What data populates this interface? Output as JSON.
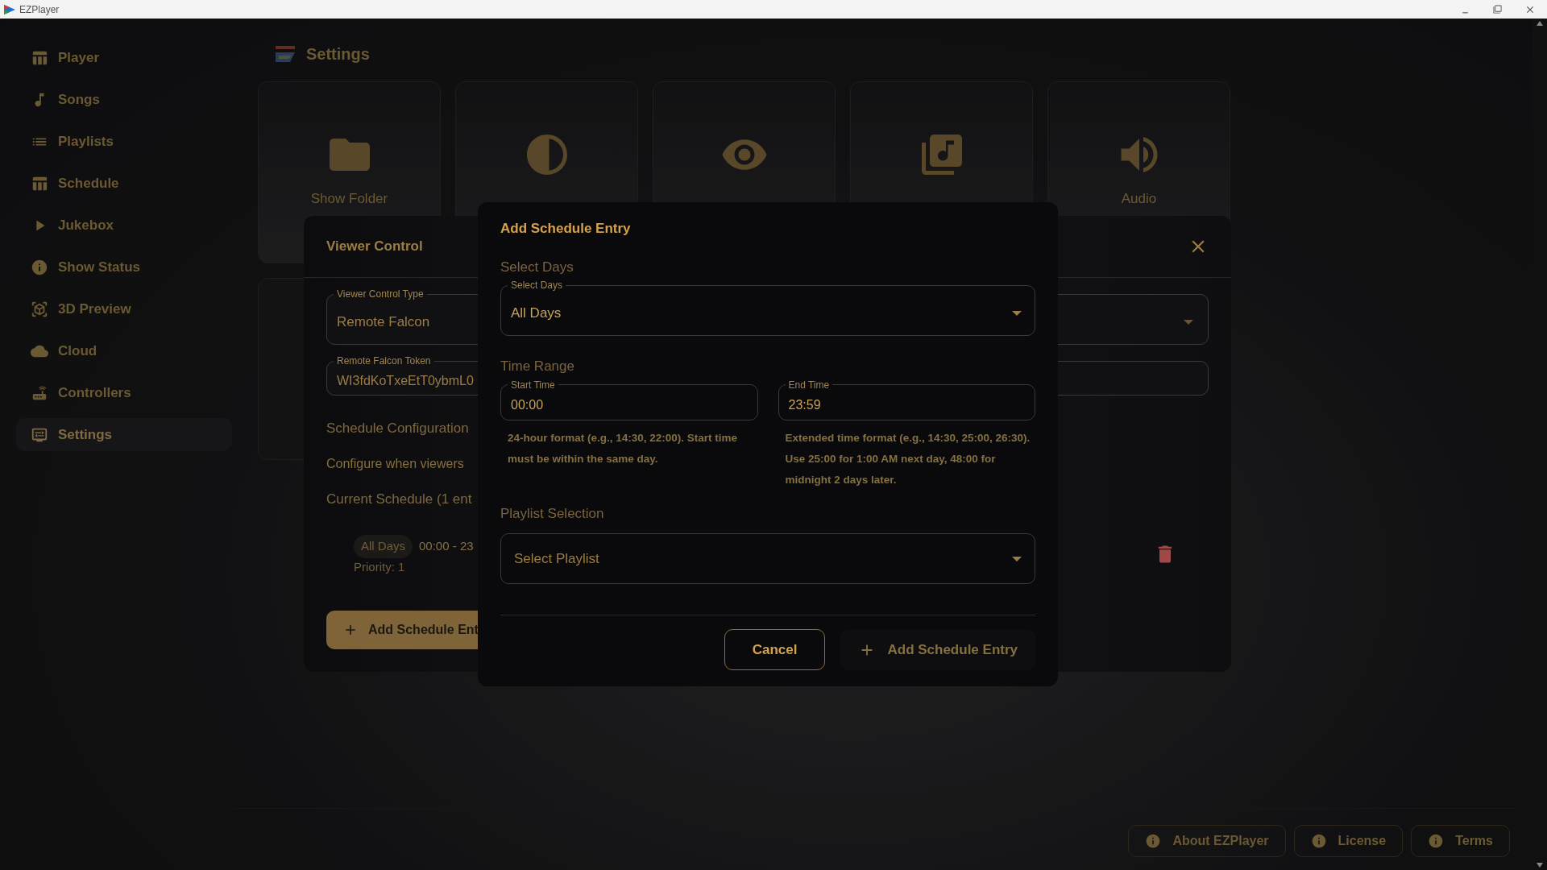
{
  "window": {
    "title": "EZPlayer"
  },
  "sidebar": {
    "items": [
      {
        "label": "Player",
        "selected": false
      },
      {
        "label": "Songs",
        "selected": false
      },
      {
        "label": "Playlists",
        "selected": false
      },
      {
        "label": "Schedule",
        "selected": false
      },
      {
        "label": "Jukebox",
        "selected": false
      },
      {
        "label": "Show Status",
        "selected": false
      },
      {
        "label": "3D Preview",
        "selected": false
      },
      {
        "label": "Cloud",
        "selected": false
      },
      {
        "label": "Controllers",
        "selected": false
      },
      {
        "label": "Settings",
        "selected": true
      }
    ]
  },
  "page": {
    "title": "Settings"
  },
  "cards": [
    {
      "kind": "labeled",
      "label": "Show Folder"
    },
    {
      "kind": "covered"
    },
    {
      "kind": "covered"
    },
    {
      "kind": "covered"
    },
    {
      "kind": "labeled",
      "label": "Audio"
    }
  ],
  "viewer_control": {
    "title": "Viewer Control",
    "type_field": {
      "label": "Viewer Control Type",
      "value": "Remote Falcon"
    },
    "token_field": {
      "label": "Remote Falcon Token",
      "value": "WI3fdKoTxeEtT0ybmL0"
    },
    "schedule_heading": "Schedule Configuration",
    "schedule_hint": "Configure when viewers",
    "current_schedule": "Current Schedule (1 ent",
    "entries": [
      {
        "days": "All Days",
        "time": "00:00 - 23",
        "priority": "Priority: 1"
      }
    ],
    "add_button": "Add Schedule Ent"
  },
  "modal": {
    "title": "Add Schedule Entry",
    "days_heading": "Select Days",
    "days_field": {
      "label": "Select Days",
      "value": "All Days"
    },
    "time_heading": "Time Range",
    "start": {
      "label": "Start Time",
      "value": "00:00",
      "help": "24-hour format (e.g., 14:30, 22:00). Start time must be within the same day."
    },
    "end": {
      "label": "End Time",
      "value": "23:59",
      "help": "Extended time format (e.g., 14:30, 25:00, 26:30). Use 25:00 for 1:00 AM next day, 48:00 for midnight 2 days later."
    },
    "playlist_heading": "Playlist Selection",
    "playlist_field": {
      "placeholder": "Select Playlist"
    },
    "buttons": [
      {
        "label": "Cancel",
        "kind": "outlined"
      },
      {
        "label": "Add Schedule Entry",
        "kind": "add"
      }
    ]
  },
  "footer": {
    "buttons": [
      "About EZPlayer",
      "License",
      "Terms"
    ]
  }
}
